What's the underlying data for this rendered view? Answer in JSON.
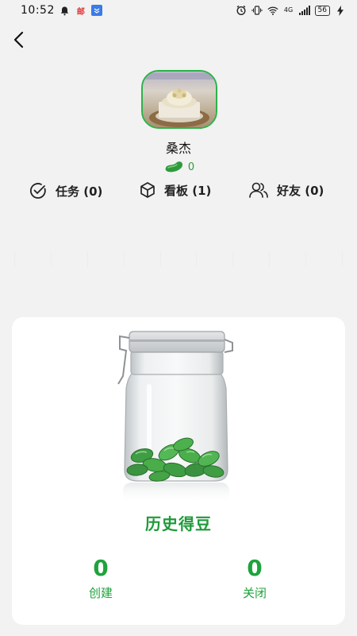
{
  "status_bar": {
    "time": "10:52",
    "mail_label": "邮",
    "network": "4G",
    "battery": "56"
  },
  "profile": {
    "name": "桑杰",
    "beans": "0"
  },
  "stats": {
    "tasks": "任务 (0)",
    "boards": "看板 (1)",
    "friends": "好友 (0)"
  },
  "card": {
    "title": "历史得豆",
    "created_value": "0",
    "created_label": "创建",
    "closed_value": "0",
    "closed_label": "关闭"
  },
  "colors": {
    "accent_green": "#1ea33c",
    "avatar_border": "#2db34a",
    "background": "#f2f2f2"
  }
}
